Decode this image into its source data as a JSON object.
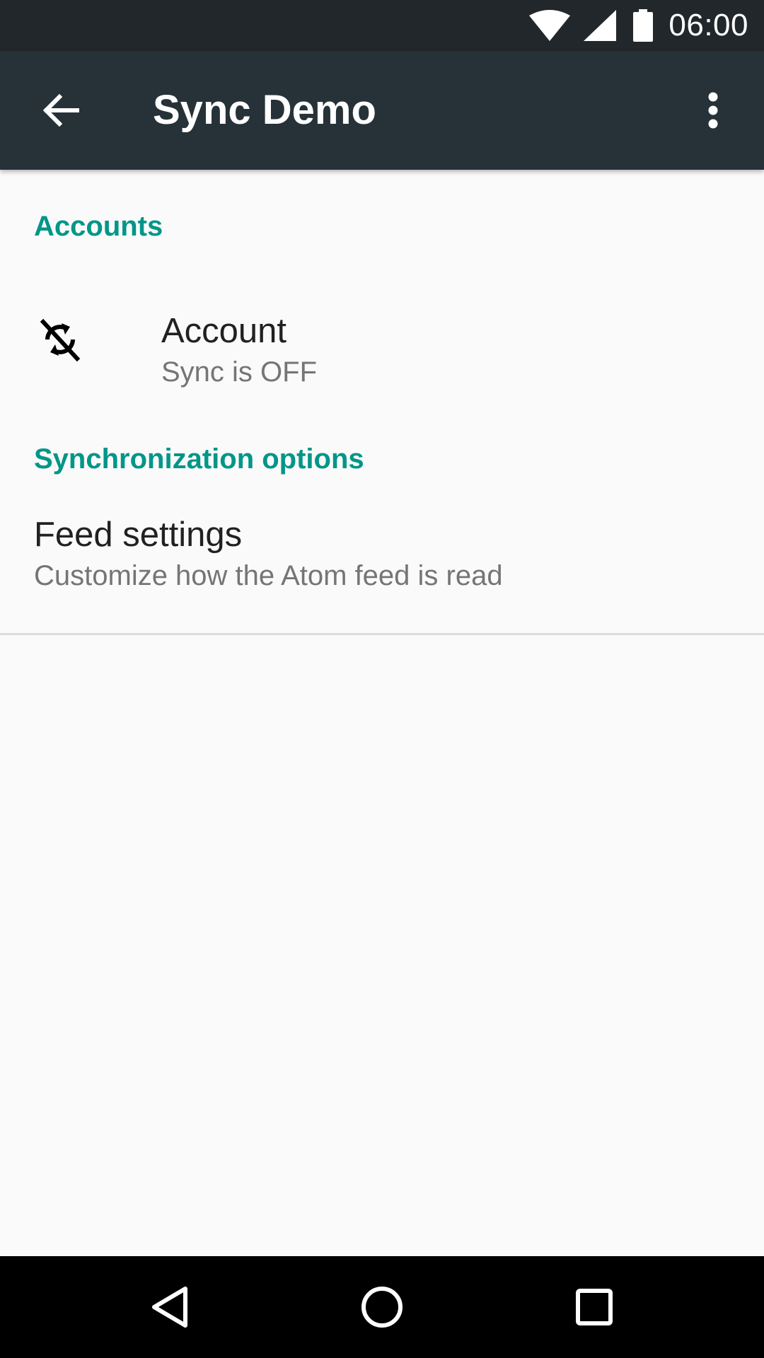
{
  "status_bar": {
    "time": "06:00",
    "icons": [
      "wifi-icon",
      "signal-icon",
      "battery-icon"
    ]
  },
  "app_bar": {
    "title": "Sync Demo",
    "back_icon": "arrow-back-icon",
    "menu_icon": "overflow-menu-icon",
    "background": "#263238"
  },
  "preferences": {
    "accounts_header": "Accounts",
    "account": {
      "title": "Account",
      "summary": "Sync is OFF",
      "icon": "sync-disabled-icon"
    },
    "sync_header": "Synchronization options",
    "feed": {
      "title": "Feed settings",
      "summary": "Customize how the Atom feed is read"
    }
  },
  "navigation_bar": {
    "icons": [
      "back-nav-icon",
      "home-nav-icon",
      "recents-nav-icon"
    ]
  },
  "colors": {
    "accent": "#009688",
    "status_bar": "#21272b",
    "background": "#fafafa"
  }
}
